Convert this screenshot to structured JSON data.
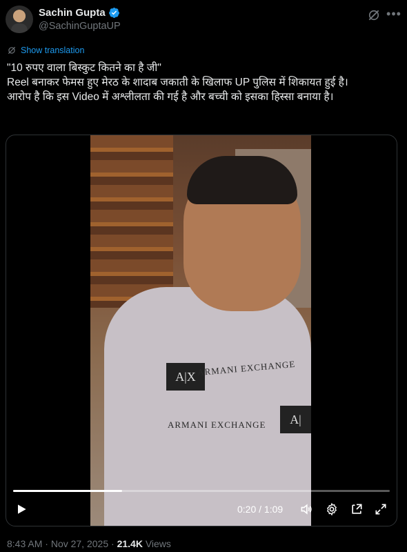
{
  "author": {
    "name": "Sachin Gupta",
    "handle": "@SachinGuptaUP"
  },
  "translation_link": "Show translation",
  "tweet_lines": [
    "\"10 रुपए वाला बिस्कुट कितने का है जी\"",
    "Reel बनाकर फेमस हुए मेरठ के शादाब जकाती के खिलाफ UP पुलिस में शिकायत हुई है।",
    "आरोप है कि इस Video में अश्लीलता की गई है और बच्ची को इसका हिस्सा बनाया है।"
  ],
  "video": {
    "time_display": "0:20 / 1:09",
    "progress": 0.29,
    "sweater_text_1": "ARMANI EXCHANGE",
    "sweater_text_2": "ARMANI EXCHANGE",
    "badge_1": "A|X",
    "badge_2": "A|"
  },
  "meta": {
    "time": "8:43 AM",
    "separator": "·",
    "date": "Nov 27, 2025",
    "views_count": "21.4K",
    "views_label": "Views"
  },
  "colors": {
    "accent": "#1d9bf0",
    "muted": "#71767b",
    "text": "#e7e9ea"
  }
}
